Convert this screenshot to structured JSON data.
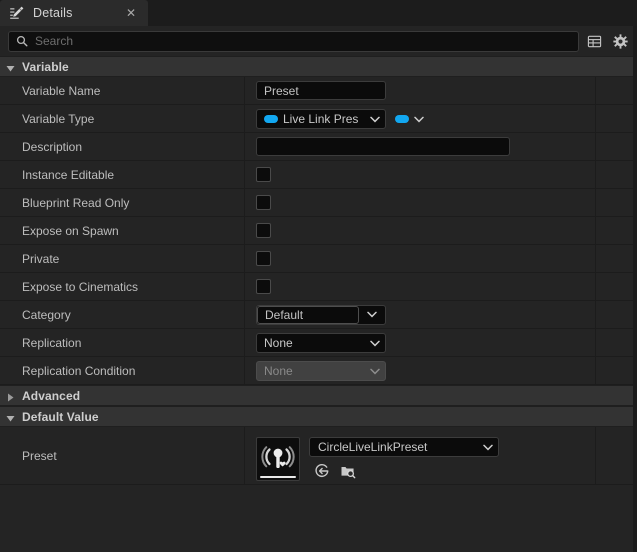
{
  "tab": {
    "title": "Details",
    "icon": "details-pencil-icon",
    "close_label": "✕"
  },
  "search": {
    "placeholder": "Search",
    "value": "",
    "icon": "search-icon",
    "tools": [
      {
        "name": "column-layout-icon",
        "label": ""
      },
      {
        "name": "settings-gear-icon",
        "label": ""
      }
    ]
  },
  "colors": {
    "accent_blue": "#12A7F0",
    "panel_bg": "#242424",
    "section_bg": "#333333",
    "field_bg": "#0B0B0B"
  },
  "sections": [
    {
      "id": "variable",
      "label": "Variable",
      "expanded": true
    },
    {
      "id": "advanced",
      "label": "Advanced",
      "expanded": false
    },
    {
      "id": "default_value",
      "label": "Default Value",
      "expanded": true
    }
  ],
  "variable_rows": {
    "variable_name": {
      "label": "Variable Name",
      "value": "Preset"
    },
    "variable_type": {
      "label": "Variable Type",
      "value": "Live Link Pres",
      "pill_color": "#12A7F0",
      "sub_pill_color": "#12A7F0"
    },
    "description": {
      "label": "Description",
      "value": "",
      "placeholder": ""
    },
    "instance_editable": {
      "label": "Instance Editable",
      "checked": false
    },
    "blueprint_read_only": {
      "label": "Blueprint Read Only",
      "checked": false
    },
    "expose_on_spawn": {
      "label": "Expose on Spawn",
      "checked": false
    },
    "private": {
      "label": "Private",
      "checked": false
    },
    "expose_to_cinematics": {
      "label": "Expose to Cinematics",
      "checked": false
    },
    "category": {
      "label": "Category",
      "value": "Default"
    },
    "replication": {
      "label": "Replication",
      "value": "None"
    },
    "replication_condition": {
      "label": "Replication Condition",
      "value": "None",
      "disabled": true
    }
  },
  "default_value_row": {
    "label": "Preset",
    "asset_name": "CircleLiveLinkPreset",
    "thumbnail_icon": "live-link-preset-icon",
    "actions": [
      {
        "name": "use-selected-asset-icon",
        "label": ""
      },
      {
        "name": "browse-to-asset-icon",
        "label": ""
      }
    ]
  }
}
